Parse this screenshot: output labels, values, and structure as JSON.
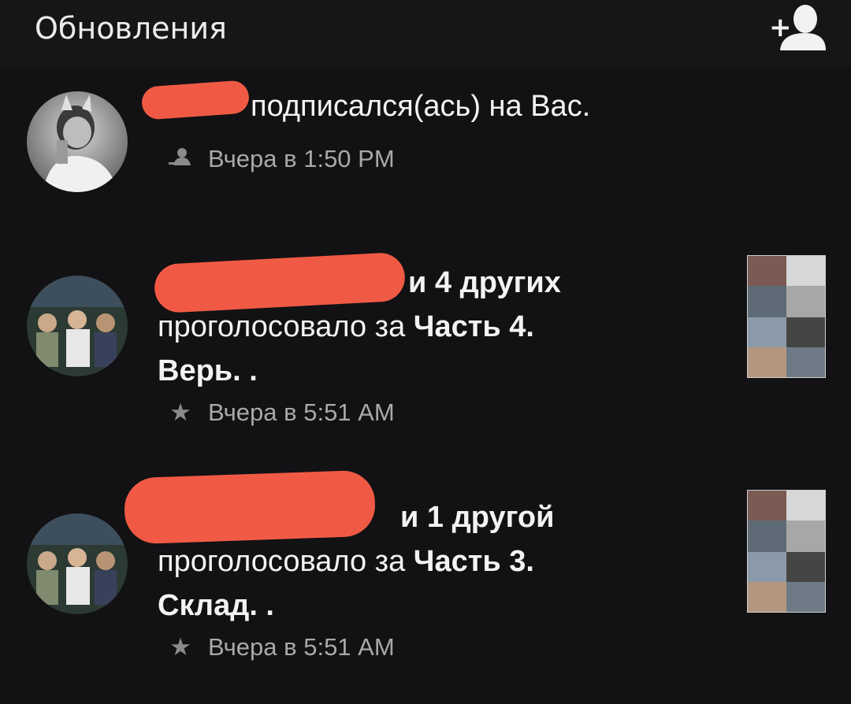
{
  "header": {
    "title": "Обновления",
    "add_friend_icon": "add-user-icon"
  },
  "colors": {
    "background": "#121113",
    "redaction": "#f05a45",
    "meta_text": "#a9a9a9"
  },
  "notifications": [
    {
      "type": "follow",
      "text_suffix": "подписался(ась) на Вас.",
      "meta_icon": "user-icon",
      "time": "Вчера в 1:50 PM"
    },
    {
      "type": "vote",
      "others": "и 4 других",
      "action": "проголосовало за",
      "chapter": "Часть 4.",
      "chapter_cont": "Верь. .",
      "meta_icon": "star-icon",
      "time": "Вчера в 5:51 AM"
    },
    {
      "type": "vote",
      "others": "и 1 другой",
      "action": "проголосовало за",
      "chapter": "Часть 3.",
      "chapter_cont": "Склад. .",
      "meta_icon": "star-icon",
      "time": "Вчера в 5:51 AM"
    }
  ]
}
